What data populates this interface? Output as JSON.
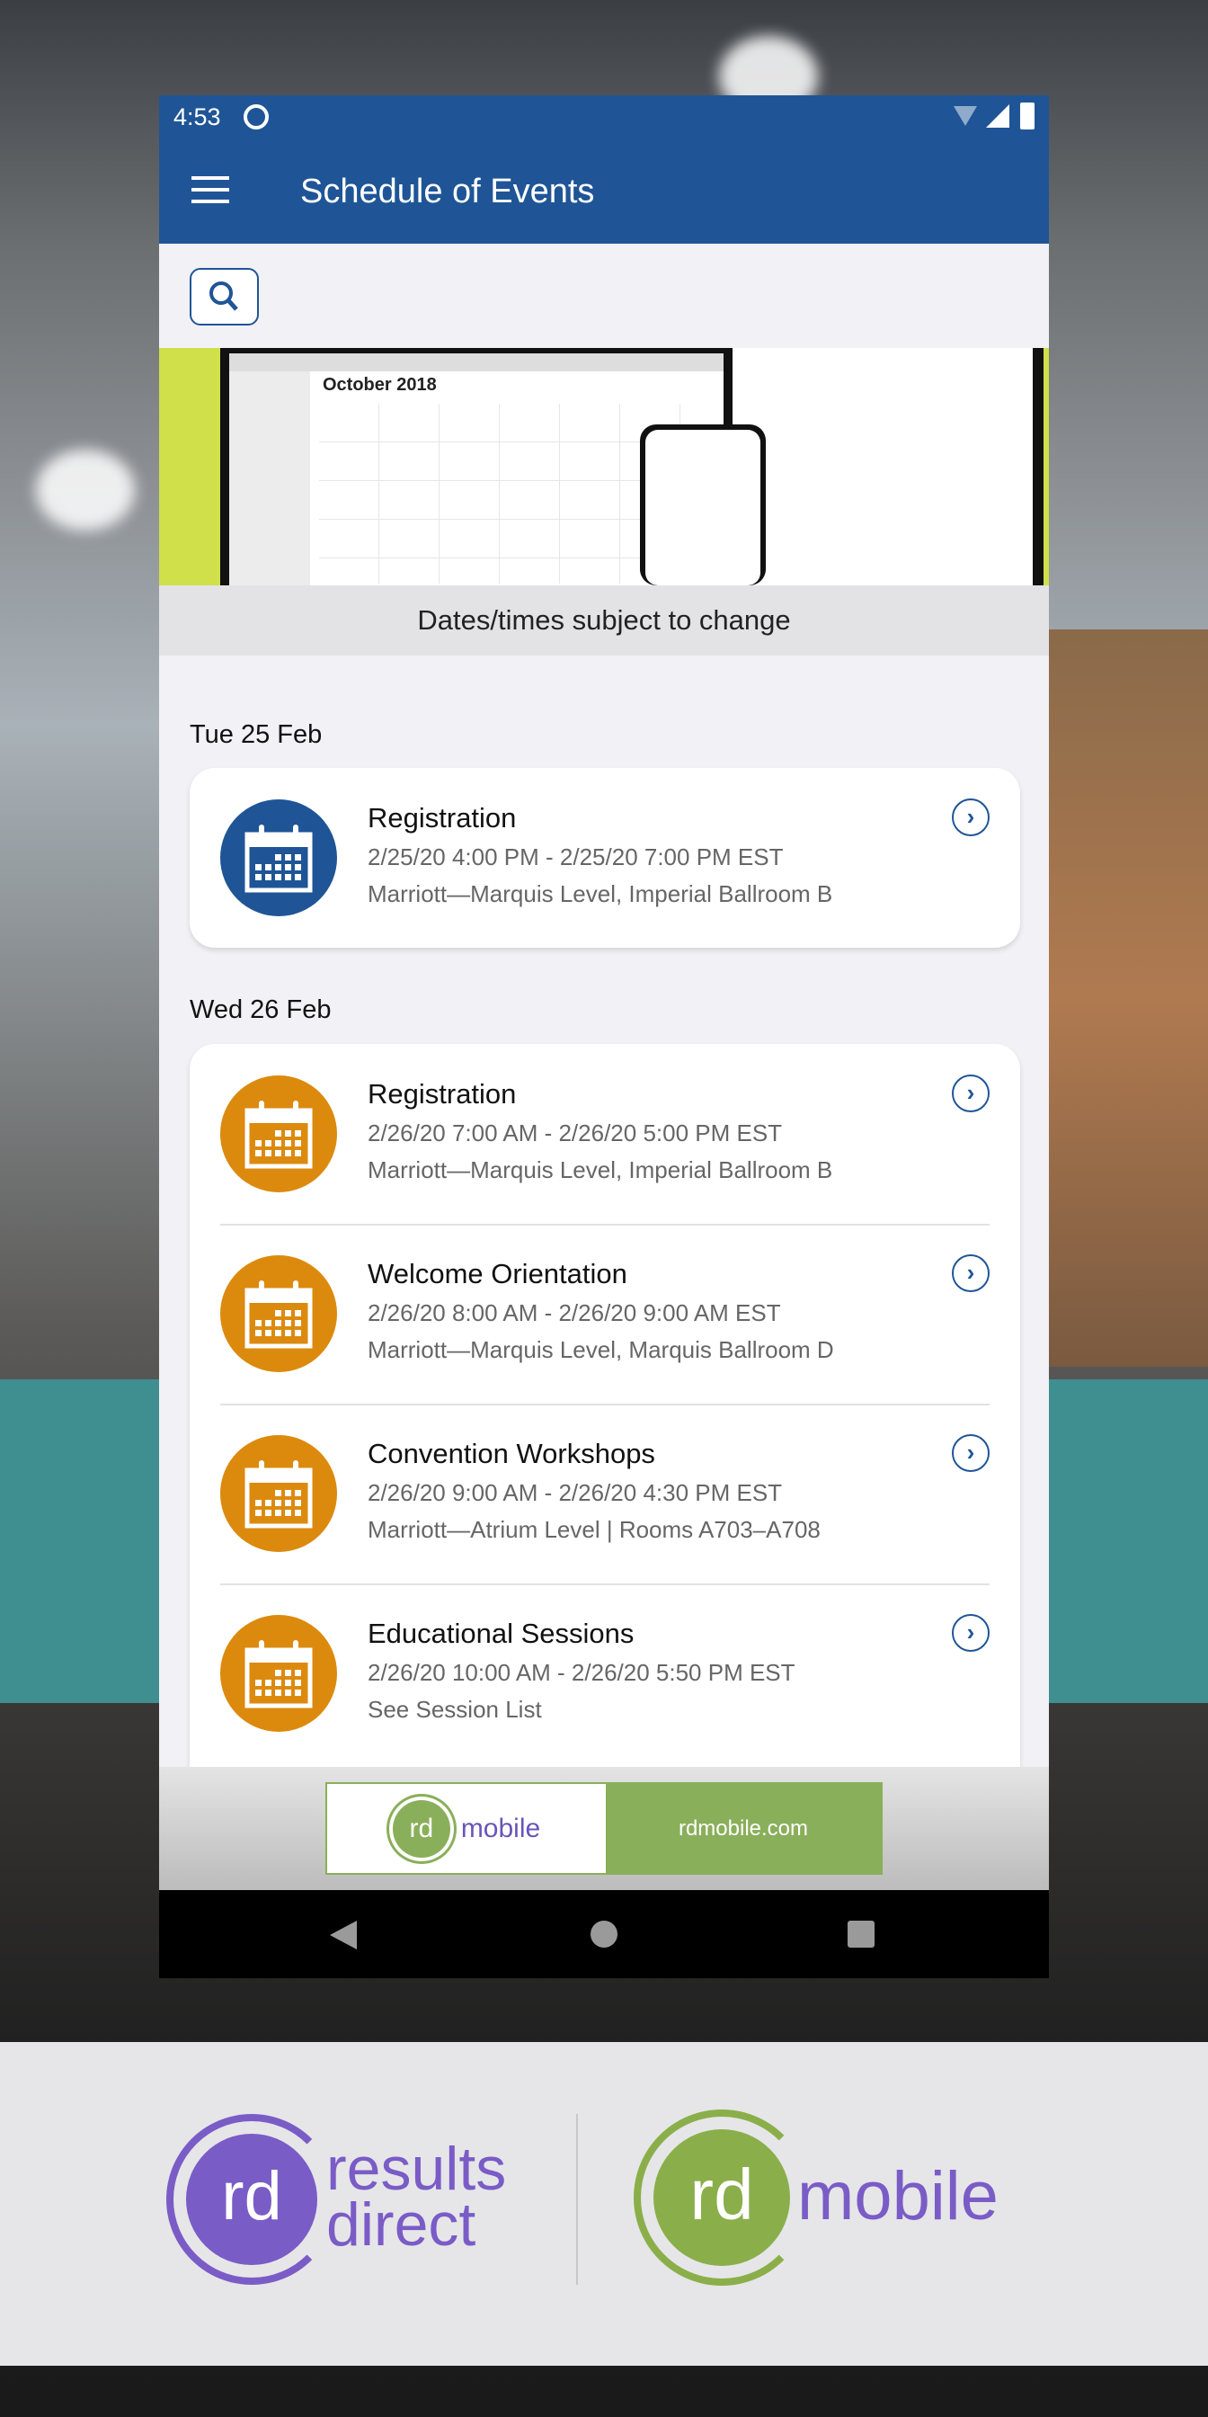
{
  "status_bar": {
    "time": "4:53"
  },
  "app_bar": {
    "title": "Schedule of Events",
    "menu_icon": "hamburger-icon"
  },
  "search": {
    "icon": "search-icon"
  },
  "banner": {
    "calendar_month": "October 2018",
    "caption": "Dates/times subject to change"
  },
  "sections": [
    {
      "date": "Tue 25 Feb",
      "icon_color": "#1f5596",
      "events": [
        {
          "title": "Registration",
          "time": "2/25/20 4:00 PM - 2/25/20 7:00 PM EST",
          "location": "Marriott—Marquis Level, Imperial Ballroom B"
        }
      ]
    },
    {
      "date": "Wed 26 Feb",
      "icon_color": "#dc8a0e",
      "events": [
        {
          "title": "Registration",
          "time": "2/26/20 7:00 AM - 2/26/20 5:00 PM EST",
          "location": "Marriott—Marquis Level, Imperial Ballroom B"
        },
        {
          "title": "Welcome Orientation",
          "time": "2/26/20 8:00 AM - 2/26/20 9:00 AM EST",
          "location": "Marriott—Marquis Level, Marquis Ballroom D"
        },
        {
          "title": "Convention Workshops",
          "time": "2/26/20 9:00 AM - 2/26/20 4:30 PM EST",
          "location": "Marriott—Atrium Level | Rooms A703–A708"
        },
        {
          "title": "Educational Sessions",
          "time": "2/26/20 10:00 AM - 2/26/20 5:50 PM EST",
          "location": "See Session List"
        }
      ]
    }
  ],
  "ad": {
    "logo_rd": "rd",
    "logo_word": "mobile",
    "url": "rdmobile.com"
  },
  "branding": {
    "left_rd": "rd",
    "left_line1": "results",
    "left_line2": "direct",
    "right_rd": "rd",
    "right_word": "mobile",
    "purple": "#7a5cc6",
    "green": "#8aaf4a"
  }
}
